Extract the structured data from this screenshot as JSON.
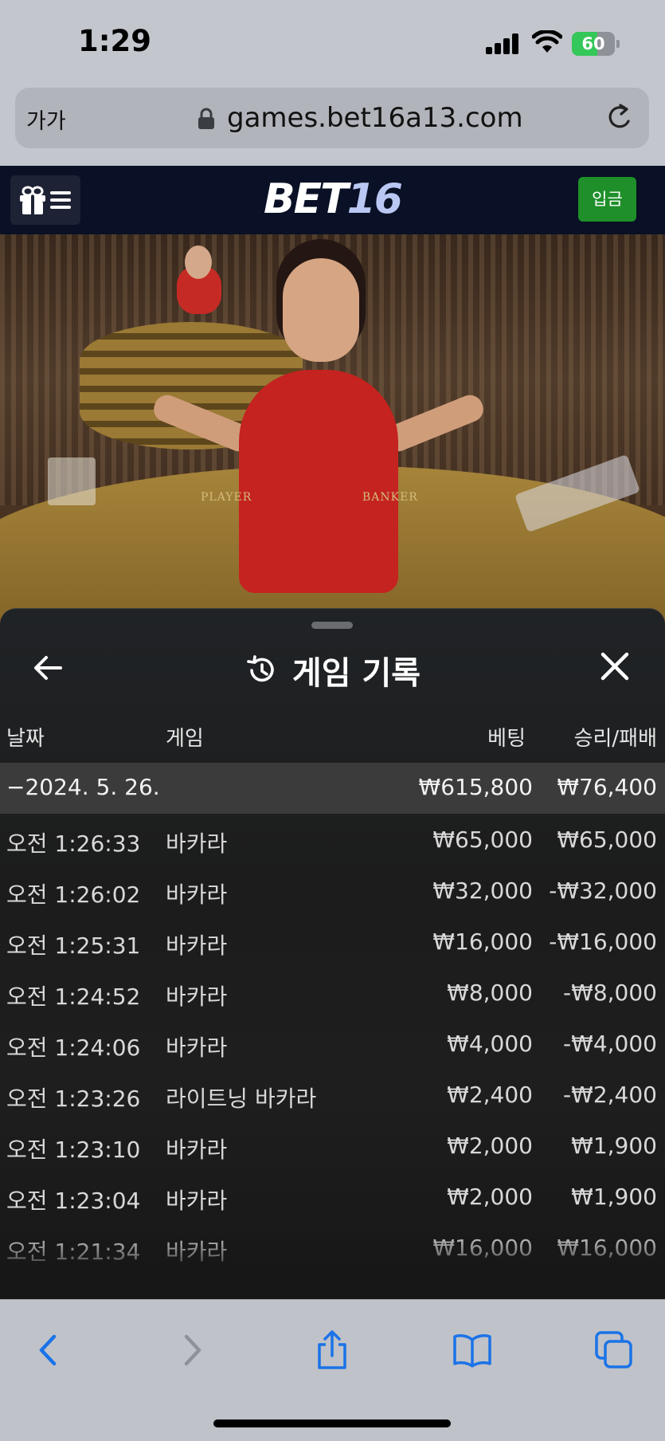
{
  "status_bar": {
    "time": "1:29",
    "battery": "60",
    "battery_level": 0.6
  },
  "url_bar": {
    "aa_label": "가가",
    "url": "games.bet16a13.com"
  },
  "header": {
    "logo_main": "BET",
    "logo_num": "16",
    "deposit_label": "입금"
  },
  "video": {
    "table_labels": [
      "PLAYER",
      "BANKER"
    ]
  },
  "history": {
    "title": "게임 기록",
    "columns": {
      "date": "날짜",
      "game": "게임",
      "bet": "베팅",
      "win_loss": "승리/패배"
    },
    "summary": {
      "date": "−2024. 5. 26.",
      "bet": "₩615,800",
      "win_loss": "₩76,400"
    },
    "rows": [
      {
        "time": "오전 1:26:33",
        "game": "바카라",
        "bet": "₩65,000",
        "win_loss": "₩65,000"
      },
      {
        "time": "오전 1:26:02",
        "game": "바카라",
        "bet": "₩32,000",
        "win_loss": "-₩32,000"
      },
      {
        "time": "오전 1:25:31",
        "game": "바카라",
        "bet": "₩16,000",
        "win_loss": "-₩16,000"
      },
      {
        "time": "오전 1:24:52",
        "game": "바카라",
        "bet": "₩8,000",
        "win_loss": "-₩8,000"
      },
      {
        "time": "오전 1:24:06",
        "game": "바카라",
        "bet": "₩4,000",
        "win_loss": "-₩4,000"
      },
      {
        "time": "오전 1:23:26",
        "game": "라이트닝 바카라",
        "bet": "₩2,400",
        "win_loss": "-₩2,400"
      },
      {
        "time": "오전 1:23:10",
        "game": "바카라",
        "bet": "₩2,000",
        "win_loss": "₩1,900"
      },
      {
        "time": "오전 1:23:04",
        "game": "바카라",
        "bet": "₩2,000",
        "win_loss": "₩1,900"
      },
      {
        "time": "오전 1:21:34",
        "game": "바카라",
        "bet": "₩16,000",
        "win_loss": "₩16,000"
      }
    ]
  },
  "toolbar": {
    "icons": [
      "back-icon",
      "forward-icon",
      "share-icon",
      "bookmarks-icon",
      "tabs-icon"
    ],
    "accent_color": "#1a73e8"
  }
}
